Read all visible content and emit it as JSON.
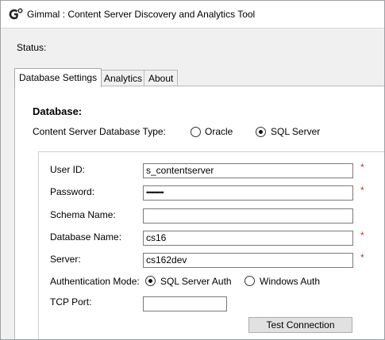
{
  "window": {
    "title": "Gimmal : Content Server Discovery and Analytics Tool",
    "status_label": "Status:"
  },
  "tabs": [
    {
      "label": "Database Settings",
      "active": true
    },
    {
      "label": "Analytics",
      "active": false
    },
    {
      "label": "About",
      "active": false
    }
  ],
  "database": {
    "section_title": "Database:",
    "db_type_label": "Content Server Database Type:",
    "db_type_options": [
      {
        "label": "Oracle",
        "selected": false
      },
      {
        "label": "SQL Server",
        "selected": true
      }
    ]
  },
  "fields": {
    "user_id": {
      "label": "User ID:",
      "value": "s_contentserver",
      "required": true
    },
    "password": {
      "label": "Password:",
      "value": "••••••••••",
      "required": true
    },
    "schema_name": {
      "label": "Schema Name:",
      "value": "",
      "required": false
    },
    "database_name": {
      "label": "Database Name:",
      "value": "cs16",
      "required": true
    },
    "server": {
      "label": "Server:",
      "value": "cs162dev",
      "required": true
    },
    "auth_mode": {
      "label": "Authentication Mode:",
      "options": [
        {
          "label": "SQL Server Auth",
          "selected": true
        },
        {
          "label": "Windows Auth",
          "selected": false
        }
      ]
    },
    "tcp_port": {
      "label": "TCP Port:",
      "value": "",
      "required": false
    }
  },
  "required_marker": "*",
  "buttons": {
    "test_connection": "Test Connection"
  },
  "colors": {
    "required": "#e0221b",
    "window_bg": "#f0f0f0",
    "panel_bg": "#ffffff"
  },
  "icons": {
    "app": "gimmal-logo-icon"
  }
}
